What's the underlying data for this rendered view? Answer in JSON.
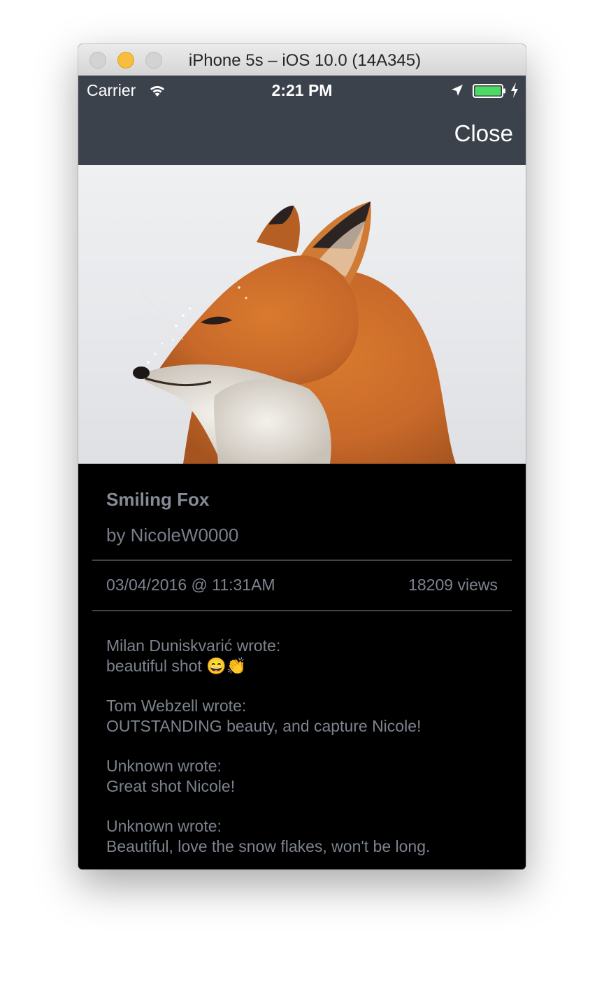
{
  "window": {
    "title": "iPhone 5s – iOS 10.0 (14A345)"
  },
  "status_bar": {
    "carrier": "Carrier",
    "time": "2:21 PM",
    "icons": [
      "wifi-icon",
      "location-arrow-icon",
      "battery-icon",
      "charging-bolt-icon"
    ]
  },
  "nav": {
    "close_label": "Close"
  },
  "photo": {
    "subject": "red fox in snow",
    "title": "Smiling Fox",
    "author": "by NicoleW0000",
    "date": "03/04/2016 @ 11:31AM",
    "views": "18209 views"
  },
  "comments": [
    {
      "author_line": "Milan Duniskvarić wrote:",
      "text": "beautiful shot 😄👏"
    },
    {
      "author_line": "Tom Webzell wrote:",
      "text": "OUTSTANDING beauty, and capture Nicole!"
    },
    {
      "author_line": "Unknown wrote:",
      "text": "Great shot Nicole!"
    },
    {
      "author_line": "Unknown wrote:",
      "text": "Beautiful, love the snow flakes, won't be long."
    }
  ],
  "colors": {
    "nav_background": "#3c424c",
    "detail_background": "#000000",
    "detail_text": "#7d838e",
    "battery_fill": "#4cd964",
    "minimize_button": "#f6be3c"
  }
}
